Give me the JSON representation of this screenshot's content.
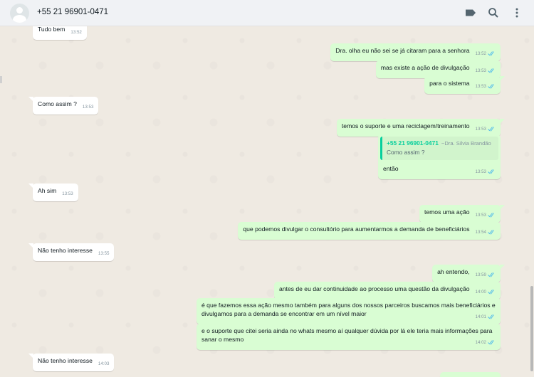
{
  "header": {
    "contact_name": "+55 21 96901-0471",
    "icons": [
      "label-icon",
      "search-icon",
      "menu-icon"
    ]
  },
  "messages": [
    {
      "dir": "in",
      "text": "Tudo bem",
      "time": "13:52"
    },
    {
      "dir": "out",
      "text": "Dra. olha eu não sei se já citaram para a senhora",
      "time": "13:52"
    },
    {
      "dir": "out",
      "text": "mas existe a ação de divulgação",
      "time": "13:53"
    },
    {
      "dir": "out",
      "text": "para o sistema",
      "time": "13:53"
    },
    {
      "dir": "in",
      "text": "Como assim ?",
      "time": "13:53"
    },
    {
      "dir": "out",
      "text": "temos o suporte e uma reciclagem/treinamento",
      "time": "13:53"
    },
    {
      "dir": "out",
      "text": "então",
      "time": "13:53",
      "quote": {
        "author": "+55 21 96901-0471",
        "name": "~Dra. Silvia Brandão",
        "text": "Como assim ?"
      }
    },
    {
      "dir": "in",
      "text": "Ah sim",
      "time": "13:53"
    },
    {
      "dir": "out",
      "text": "temos uma ação",
      "time": "13:53"
    },
    {
      "dir": "out",
      "text": "que podemos divulgar o consultório para aumentarmos a demanda de beneficiários",
      "time": "13:54"
    },
    {
      "dir": "in",
      "text": "Não tenho interesse",
      "time": "13:55"
    },
    {
      "dir": "out",
      "text": "ah entendo,",
      "time": "13:59"
    },
    {
      "dir": "out",
      "text": "antes de eu dar continuidade ao processo uma questão da divulgação",
      "time": "14:00"
    },
    {
      "dir": "out",
      "text": "é que fazemos essa ação mesmo também para alguns dos nossos parceiros buscamos mais beneficiários e divulgamos para a demanda se encontrar em um nível maior",
      "time": "14:01"
    },
    {
      "dir": "out",
      "text": "e o suporte que citei seria ainda no whats mesmo aí qualquer dúvida por lá ele teria mais informações para sanar o mesmo",
      "time": "14:02"
    },
    {
      "dir": "in",
      "text": "Não tenho interesse",
      "time": "14:03"
    }
  ],
  "colors": {
    "incoming": "#ffffff",
    "outgoing": "#d9fdd3",
    "read_ticks": "#53bdeb",
    "quote_accent": "#06cf9c",
    "background": "#efeae2"
  }
}
